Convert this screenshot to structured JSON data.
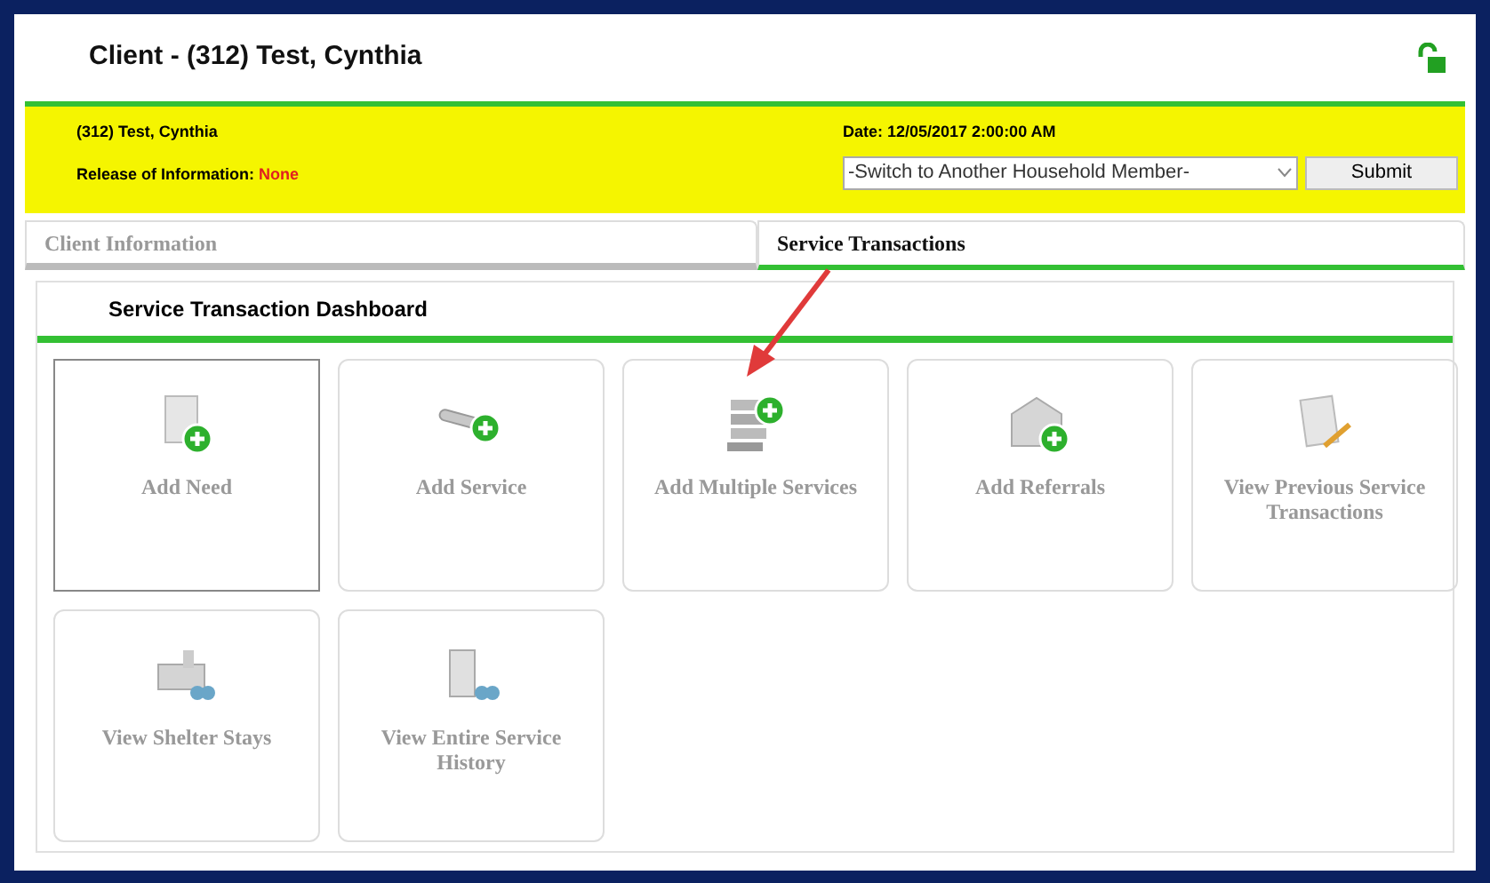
{
  "window": {
    "title": "Client - (312) Test, Cynthia"
  },
  "info_bar": {
    "client": "(312) Test, Cynthia",
    "release_label": "Release of Information:",
    "release_value": "None",
    "date": "Date: 12/05/2017 2:00:00 AM",
    "household_select": "-Switch to Another Household Member-",
    "submit": "Submit"
  },
  "tabs": [
    {
      "label": "Client Information",
      "selected": false
    },
    {
      "label": "Service Transactions",
      "selected": true
    }
  ],
  "dashboard": {
    "title": "Service Transaction Dashboard",
    "tiles": [
      {
        "label": "Add Need",
        "kind": "need",
        "selected": true
      },
      {
        "label": "Add Service",
        "kind": "service",
        "selected": false
      },
      {
        "label": "Add Multiple Services",
        "kind": "multiple",
        "selected": false
      },
      {
        "label": "Add Referrals",
        "kind": "referral",
        "selected": false
      },
      {
        "label": "View Previous Service Transactions",
        "kind": "previous",
        "selected": false
      },
      {
        "label": "View Shelter Stays",
        "kind": "shelter",
        "selected": false
      },
      {
        "label": "View Entire Service History",
        "kind": "history",
        "selected": false
      }
    ]
  }
}
